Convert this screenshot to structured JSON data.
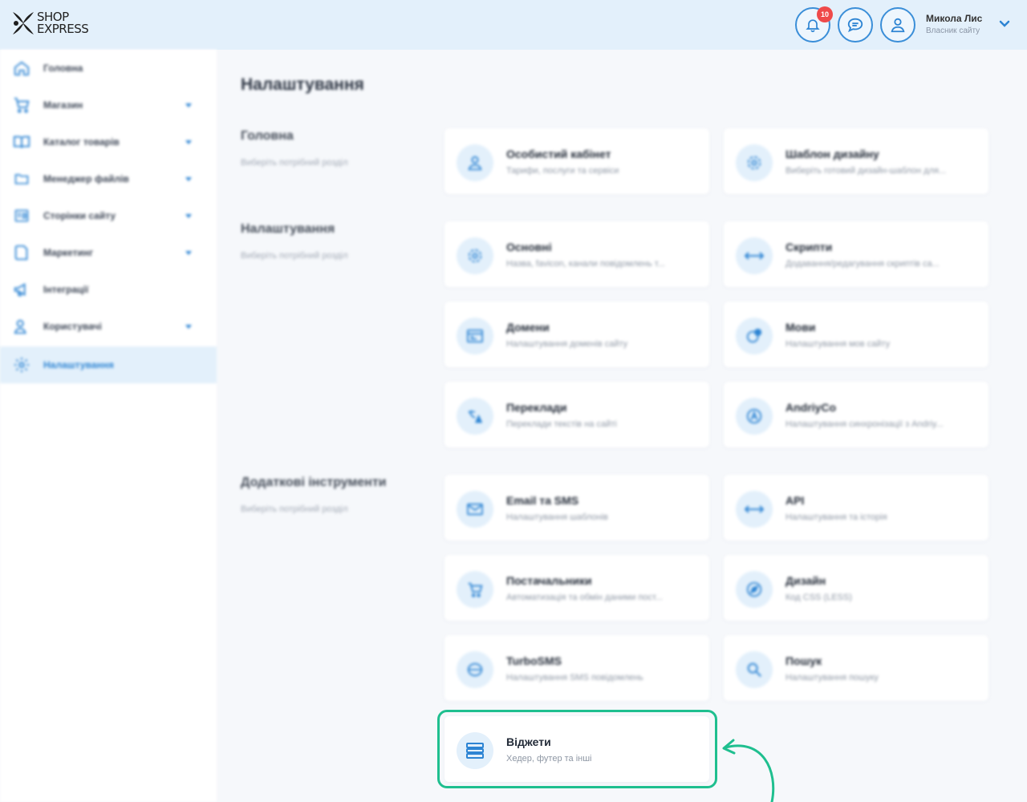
{
  "brand": {
    "line1": "SHOP",
    "line2": "EXPRESS",
    "accent": "#2d84d3",
    "highlight": "#1fbf8f"
  },
  "header": {
    "notifications_count": "10",
    "user_name": "Микола Лис",
    "user_role": "Власник сайту"
  },
  "sidebar": {
    "items": [
      {
        "label": "Головна",
        "icon": "home-icon",
        "has_submenu": false
      },
      {
        "label": "Магазин",
        "icon": "cart-icon",
        "has_submenu": true
      },
      {
        "label": "Каталог товарів",
        "icon": "book-icon",
        "has_submenu": true
      },
      {
        "label": "Менеджер файлів",
        "icon": "folder-icon",
        "has_submenu": true
      },
      {
        "label": "Сторінки сайту",
        "icon": "pages-icon",
        "has_submenu": true
      },
      {
        "label": "Маркетинг",
        "icon": "marketing-icon",
        "has_submenu": true
      },
      {
        "label": "Інтеграції",
        "icon": "megaphone-icon",
        "has_submenu": false
      },
      {
        "label": "Користувачі",
        "icon": "users-icon",
        "has_submenu": true
      },
      {
        "label": "Налаштування",
        "icon": "gear-icon",
        "has_submenu": false,
        "active": true
      }
    ]
  },
  "main": {
    "title": "Налаштування",
    "sections": [
      {
        "title": "Головна",
        "subtitle": "Виберіть потрібний розділ"
      },
      {
        "title": "Налаштування",
        "subtitle": "Виберіть потрібний розділ"
      },
      {
        "title": "Додаткові інструменти",
        "subtitle": "Виберіть потрібний розділ"
      }
    ],
    "cards": [
      {
        "title": "Особистий кабінет",
        "subtitle": "Тарифи, послуги та сервіси",
        "icon": "user-icon"
      },
      {
        "title": "Шаблон дизайну",
        "subtitle": "Виберіть готовий дизайн-шаблон для...",
        "icon": "gear-icon"
      },
      {
        "title": "Основні",
        "subtitle": "Назва, favicon, канали повідомлень т...",
        "icon": "gear-icon"
      },
      {
        "title": "Скрипти",
        "subtitle": "Додавання/редагування скриптів са...",
        "icon": "code-arrows-icon"
      },
      {
        "title": "Домени",
        "subtitle": "Налаштування доменів сайту",
        "icon": "browser-icon"
      },
      {
        "title": "Мови",
        "subtitle": "Налаштування мов сайту",
        "icon": "globe-icon"
      },
      {
        "title": "Переклади",
        "subtitle": "Переклади текстів на сайті",
        "icon": "translate-icon"
      },
      {
        "title": "AndriyCo",
        "subtitle": "Налаштування синхронізації з Andriy...",
        "icon": "a-circle-icon"
      },
      {
        "title": "Email та SMS",
        "subtitle": "Налаштування шаблонів",
        "icon": "envelope-icon"
      },
      {
        "title": "API",
        "subtitle": "Налаштування та історія",
        "icon": "code-arrows-icon"
      },
      {
        "title": "Постачальники",
        "subtitle": "Автоматизація та обмін даними пост...",
        "icon": "cart-icon"
      },
      {
        "title": "Дизайн",
        "subtitle": "Код CSS (LESS)",
        "icon": "compass-icon"
      },
      {
        "title": "TurboSMS",
        "subtitle": "Налаштування SMS повідомлень",
        "icon": "turbosms-icon"
      },
      {
        "title": "Пошук",
        "subtitle": "Налаштування пошуку",
        "icon": "search-icon"
      },
      {
        "title": "Віджети",
        "subtitle": "Хедер, футер та інші",
        "icon": "widgets-icon"
      }
    ]
  }
}
